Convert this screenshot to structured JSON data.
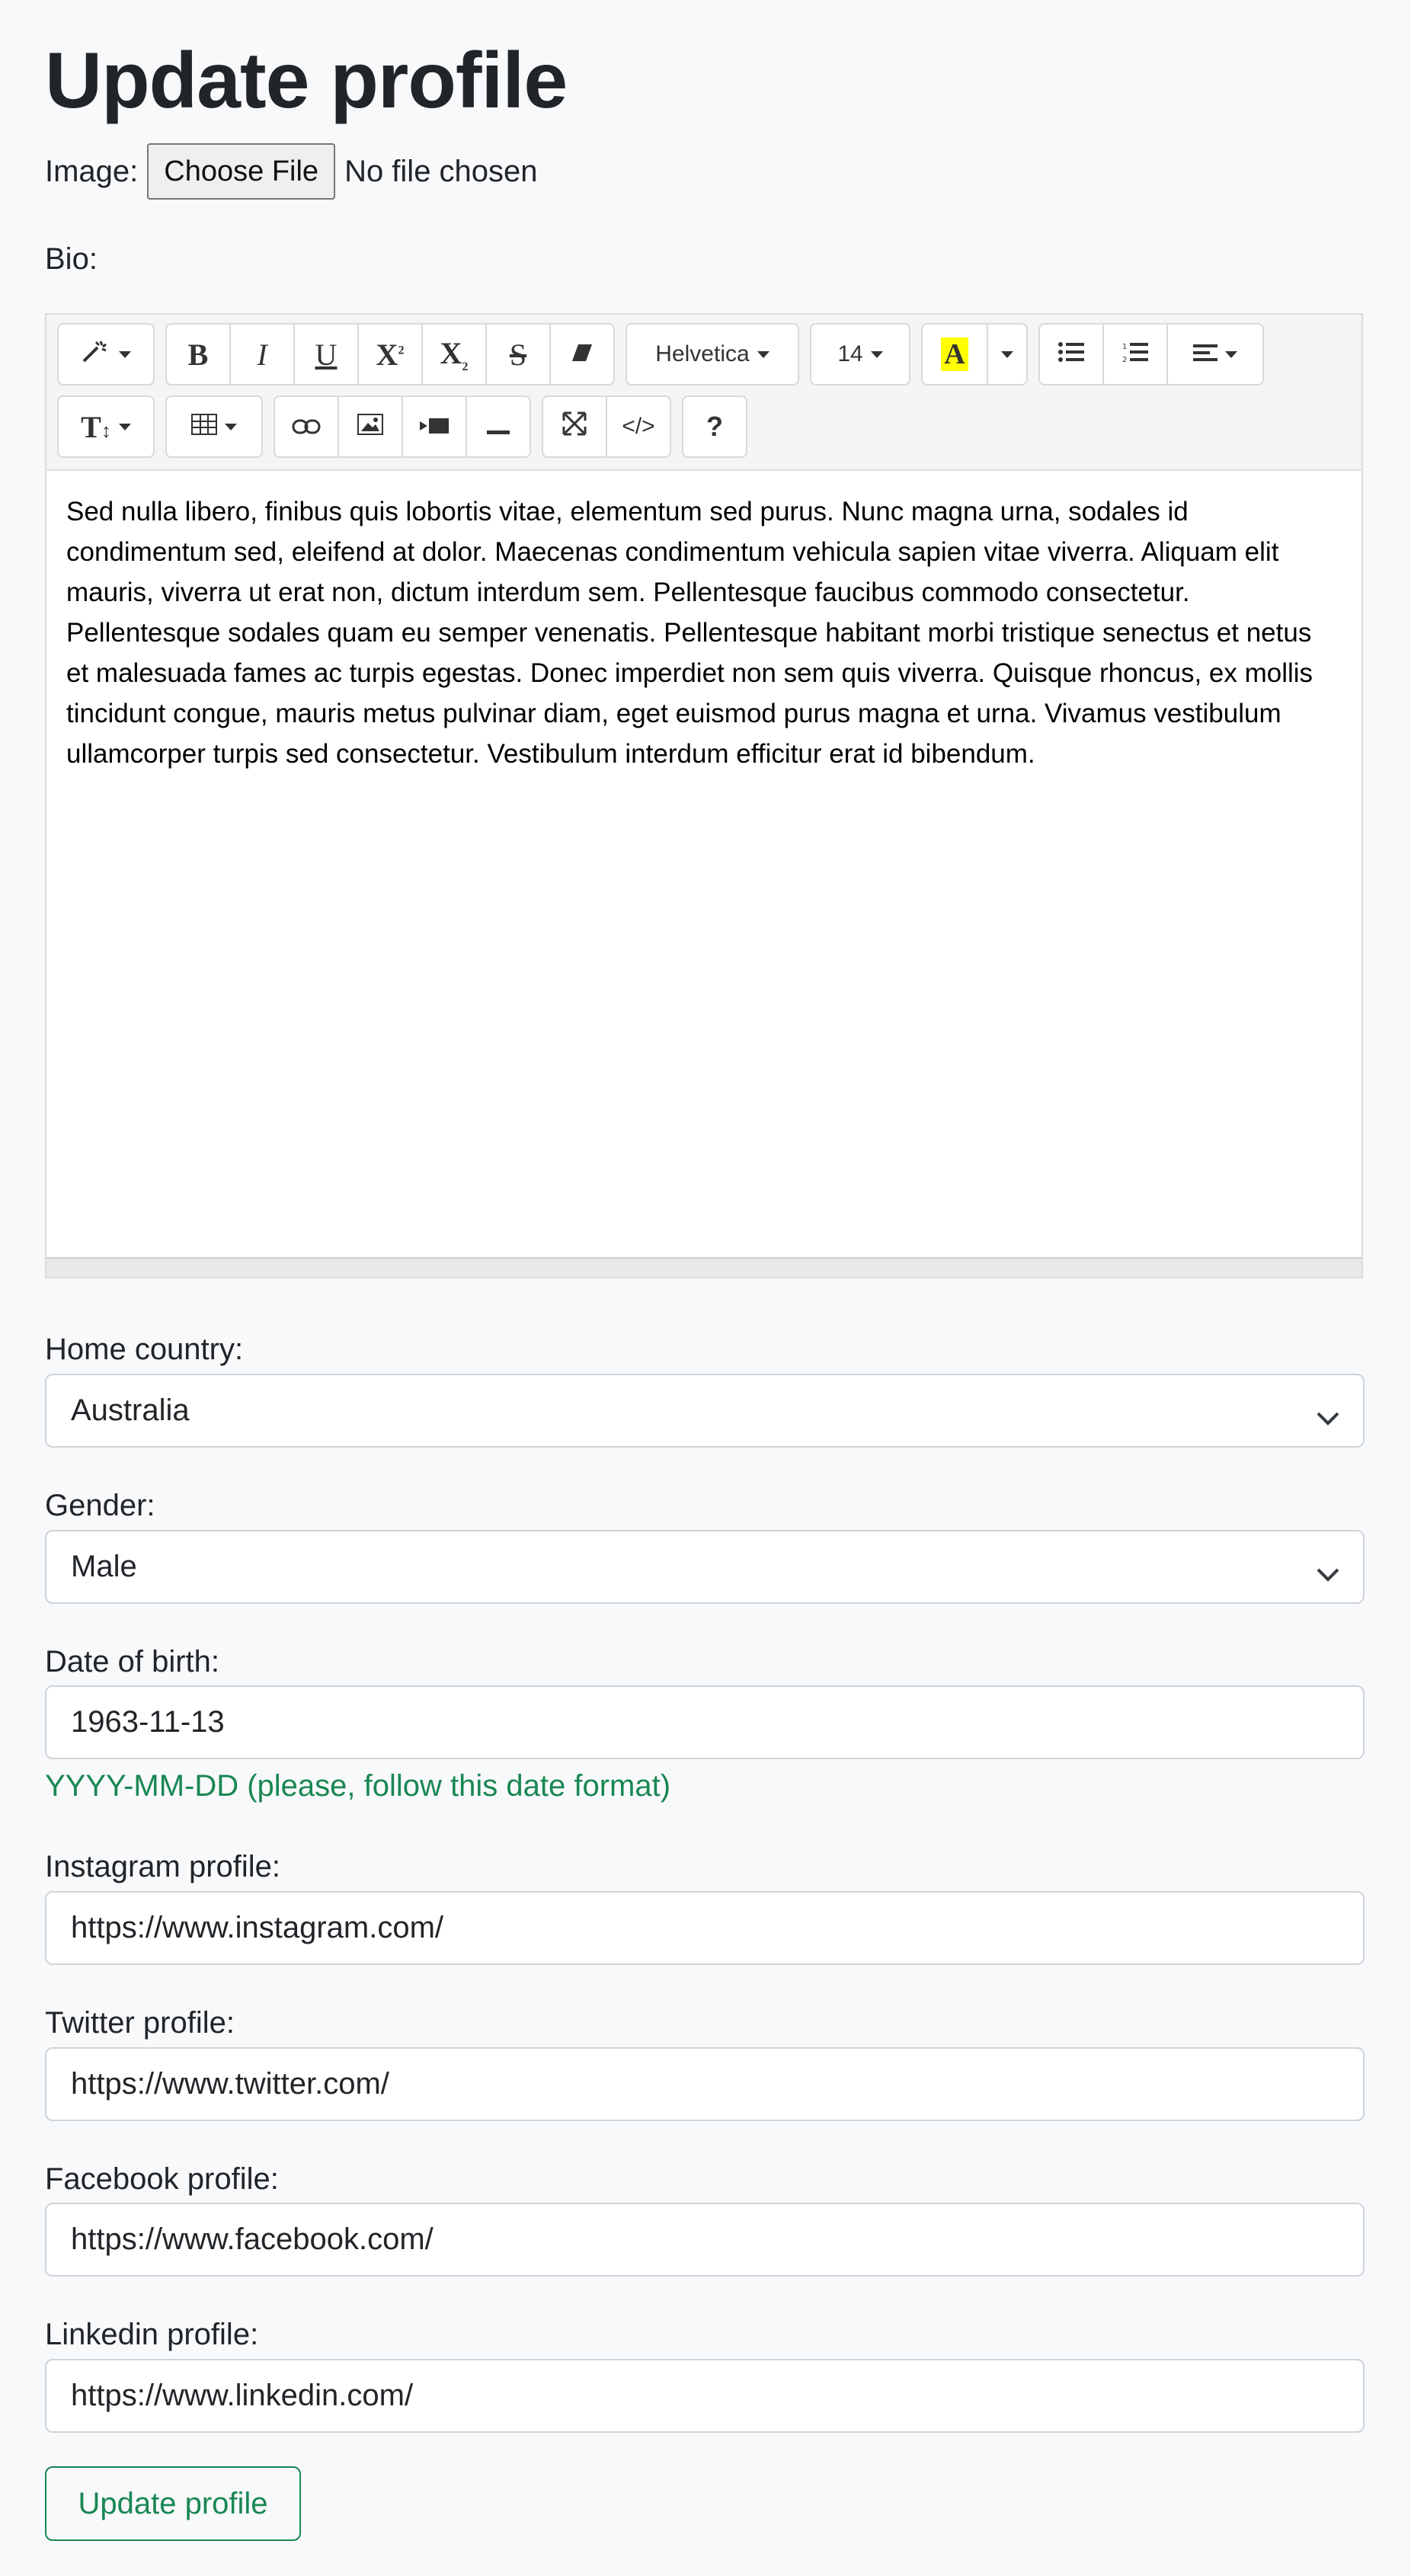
{
  "page": {
    "title": "Update profile"
  },
  "image_field": {
    "label": "Image:",
    "button_label": "Choose File",
    "status": "No file chosen"
  },
  "bio": {
    "label": "Bio:",
    "toolbar": {
      "font_family": "Helvetica",
      "font_size": "14",
      "highlight_glyph": "A",
      "help_glyph": "?",
      "code_glyph": "</>"
    },
    "content": "Sed nulla libero, finibus quis lobortis vitae, elementum sed purus. Nunc magna urna, sodales id condimentum sed, eleifend at dolor. Maecenas condimentum vehicula sapien vitae viverra. Aliquam elit mauris, viverra ut erat non, dictum interdum sem. Pellentesque faucibus commodo consectetur. Pellentesque sodales quam eu semper venenatis. Pellentesque habitant morbi tristique senectus et netus et malesuada fames ac turpis egestas. Donec imperdiet non sem quis viverra. Quisque rhoncus, ex mollis tincidunt congue, mauris metus pulvinar diam, eget euismod purus magna et urna. Vivamus vestibulum ullamcorper turpis sed consectetur. Vestibulum interdum efficitur erat id bibendum."
  },
  "home_country": {
    "label": "Home country:",
    "value": "Australia"
  },
  "gender": {
    "label": "Gender:",
    "value": "Male"
  },
  "dob": {
    "label": "Date of birth:",
    "value": "1963-11-13",
    "help": "YYYY-MM-DD (please, follow this date format)"
  },
  "instagram": {
    "label": "Instagram profile:",
    "value": "https://www.instagram.com/"
  },
  "twitter": {
    "label": "Twitter profile:",
    "value": "https://www.twitter.com/"
  },
  "facebook": {
    "label": "Facebook profile:",
    "value": "https://www.facebook.com/"
  },
  "linkedin": {
    "label": "Linkedin profile:",
    "value": "https://www.linkedin.com/"
  },
  "submit": {
    "label": "Update profile"
  },
  "colors": {
    "success": "#198754",
    "highlight": "#ffff00",
    "border": "#ced4da"
  }
}
